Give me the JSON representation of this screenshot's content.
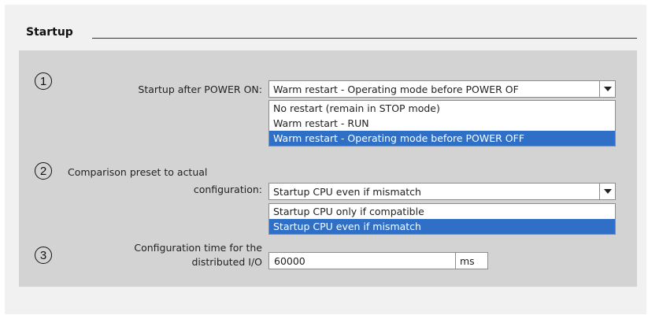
{
  "section": {
    "title": "Startup"
  },
  "markers": [
    "1",
    "2",
    "3"
  ],
  "startup_power_on": {
    "label": "Startup after POWER ON:",
    "value": "Warm restart - Operating mode before POWER OF",
    "options": [
      "No restart (remain in STOP mode)",
      "Warm restart - RUN",
      "Warm restart - Operating mode before POWER OFF"
    ],
    "selected_index": 2
  },
  "comparison_preset": {
    "label_line1": "Comparison preset to actual",
    "label_line2": "configuration:",
    "value": "Startup CPU even if mismatch",
    "options": [
      "Startup CPU only if compatible",
      "Startup CPU even if mismatch"
    ],
    "selected_index": 1
  },
  "config_time": {
    "label_line1": "Configuration time for the",
    "label_line2": "distributed I/O",
    "value": "60000",
    "unit": "ms"
  },
  "colors": {
    "panel": "#d3d3d3",
    "selection": "#2f6fc5",
    "frame": "#f1f1f1"
  },
  "icons": {
    "dropdown": "chevron-down-icon"
  }
}
